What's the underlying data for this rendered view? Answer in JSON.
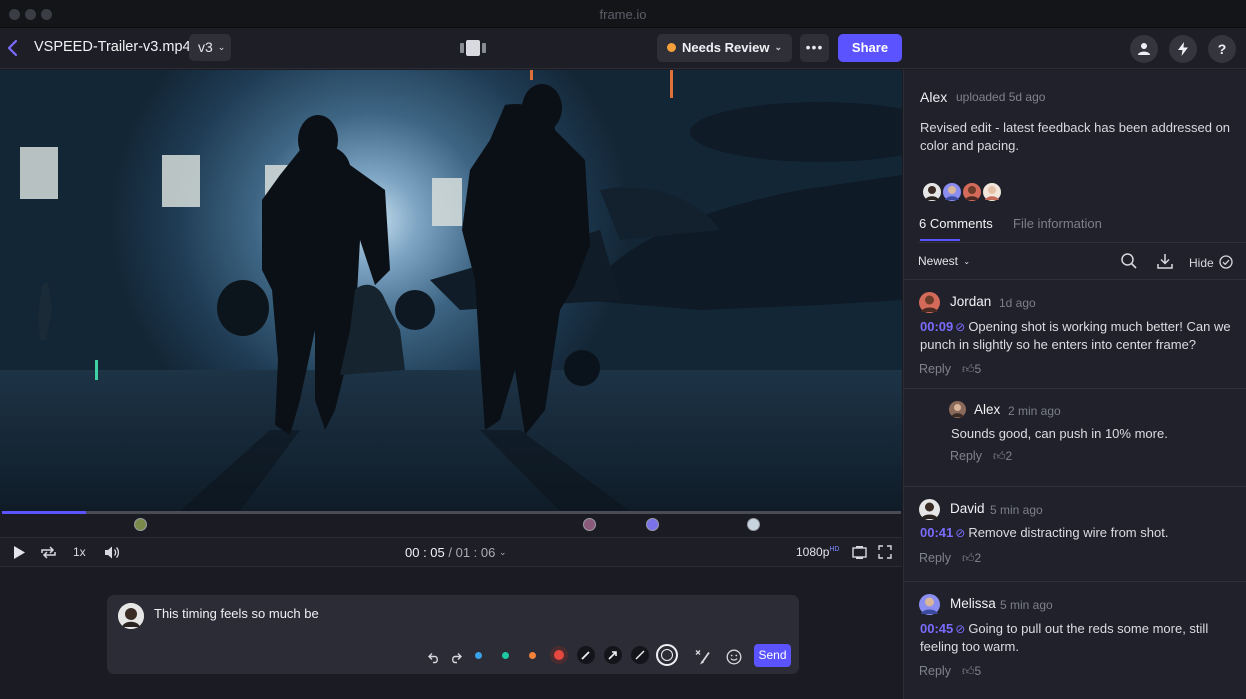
{
  "window": {
    "title": "frame.io"
  },
  "header": {
    "back_icon": "chevron-left-icon",
    "file_name": "VSPEED-Trailer-v3.mp4",
    "version": "v3",
    "status": {
      "label": "Needs Review",
      "color": "#f5a03b"
    },
    "more_label": "•••",
    "share_label": "Share",
    "account_icons": [
      "user-icon",
      "bolt-icon",
      "help-icon"
    ],
    "help_label": "?"
  },
  "player": {
    "current_time": "00 : 05",
    "duration": "01 : 06",
    "speed": "1x",
    "quality": "1080p",
    "quality_badge": "HD",
    "progress_fraction": 0.093
  },
  "composer": {
    "text": "This timing feels so much be",
    "send_label": "Send",
    "color_options": [
      "#3aa0e8",
      "#1fc8a4",
      "#f2823a",
      "#e5483e"
    ]
  },
  "upload": {
    "user": "Alex",
    "meta": "uploaded 5d ago",
    "description": "Revised edit - latest feedback has been addressed on color and pacing."
  },
  "tabs": {
    "comments": "6 Comments",
    "file_info": "File information"
  },
  "comments_toolbar": {
    "sort": "Newest",
    "hide": "Hide"
  },
  "comments": [
    {
      "name": "Jordan",
      "time": "1d ago",
      "stamp": "00:09",
      "text": "Opening shot is working much better! Can we punch in slightly so he enters into center frame?",
      "reply": "Reply",
      "likes": "5"
    },
    {
      "name": "Alex",
      "time": "2 min ago",
      "text": "Sounds good, can push in 10% more.",
      "reply": "Reply",
      "likes": "2"
    },
    {
      "name": "David",
      "time": "5 min ago",
      "stamp": "00:41",
      "text": "Remove distracting wire from shot.",
      "reply": "Reply",
      "likes": "2"
    },
    {
      "name": "Melissa",
      "time": "5 min ago",
      "stamp": "00:45",
      "text": "Going to pull out the reds some more, still feeling too warm.",
      "reply": "Reply",
      "likes": "5"
    }
  ]
}
